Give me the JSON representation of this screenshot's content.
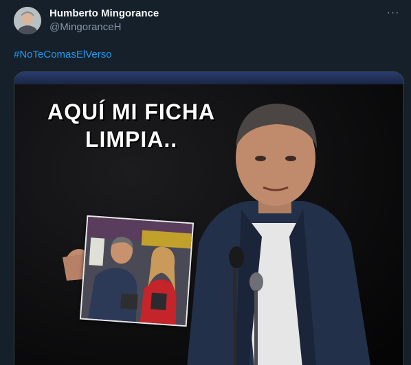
{
  "author": {
    "display_name": "Humberto Mingorance",
    "handle": "@MingoranceH",
    "avatar_icon": "user-avatar-photo"
  },
  "more_icon": "more-options-icon",
  "tweet": {
    "hashtag": "#NoTeComasElVerso"
  },
  "media": {
    "caption_line1": "AQUÍ MI FICHA",
    "caption_line2": "LIMPIA.."
  },
  "colors": {
    "background": "#15202b",
    "link": "#1d9bf0",
    "secondary_text": "#8b98a5"
  }
}
